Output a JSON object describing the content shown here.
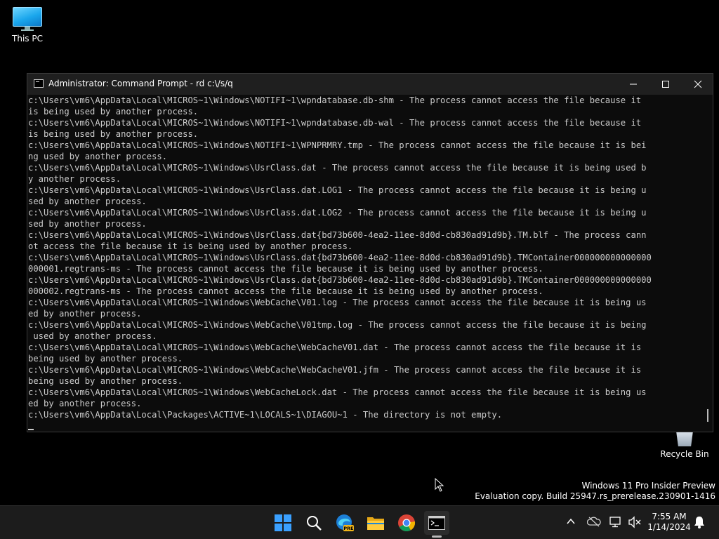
{
  "desktop": {
    "icons": [
      {
        "label": "This PC"
      },
      {
        "label": "Recycle Bin"
      }
    ]
  },
  "window": {
    "title": "Administrator: Command Prompt - rd  c:\\/s/q",
    "console_lines": [
      "c:\\Users\\vm6\\AppData\\Local\\MICROS~1\\Windows\\NOTIFI~1\\wpndatabase.db-shm - The process cannot access the file because it",
      "is being used by another process.",
      "c:\\Users\\vm6\\AppData\\Local\\MICROS~1\\Windows\\NOTIFI~1\\wpndatabase.db-wal - The process cannot access the file because it",
      "is being used by another process.",
      "c:\\Users\\vm6\\AppData\\Local\\MICROS~1\\Windows\\NOTIFI~1\\WPNPRMRY.tmp - The process cannot access the file because it is bei",
      "ng used by another process.",
      "c:\\Users\\vm6\\AppData\\Local\\MICROS~1\\Windows\\UsrClass.dat - The process cannot access the file because it is being used b",
      "y another process.",
      "c:\\Users\\vm6\\AppData\\Local\\MICROS~1\\Windows\\UsrClass.dat.LOG1 - The process cannot access the file because it is being u",
      "sed by another process.",
      "c:\\Users\\vm6\\AppData\\Local\\MICROS~1\\Windows\\UsrClass.dat.LOG2 - The process cannot access the file because it is being u",
      "sed by another process.",
      "c:\\Users\\vm6\\AppData\\Local\\MICROS~1\\Windows\\UsrClass.dat{bd73b600-4ea2-11ee-8d0d-cb830ad91d9b}.TM.blf - The process cann",
      "ot access the file because it is being used by another process.",
      "c:\\Users\\vm6\\AppData\\Local\\MICROS~1\\Windows\\UsrClass.dat{bd73b600-4ea2-11ee-8d0d-cb830ad91d9b}.TMContainer000000000000000",
      "000001.regtrans-ms - The process cannot access the file because it is being used by another process.",
      "c:\\Users\\vm6\\AppData\\Local\\MICROS~1\\Windows\\UsrClass.dat{bd73b600-4ea2-11ee-8d0d-cb830ad91d9b}.TMContainer000000000000000",
      "000002.regtrans-ms - The process cannot access the file because it is being used by another process.",
      "c:\\Users\\vm6\\AppData\\Local\\MICROS~1\\Windows\\WebCache\\V01.log - The process cannot access the file because it is being us",
      "ed by another process.",
      "c:\\Users\\vm6\\AppData\\Local\\MICROS~1\\Windows\\WebCache\\V01tmp.log - The process cannot access the file because it is being",
      " used by another process.",
      "c:\\Users\\vm6\\AppData\\Local\\MICROS~1\\Windows\\WebCache\\WebCacheV01.dat - The process cannot access the file because it is",
      "being used by another process.",
      "c:\\Users\\vm6\\AppData\\Local\\MICROS~1\\Windows\\WebCache\\WebCacheV01.jfm - The process cannot access the file because it is",
      "being used by another process.",
      "c:\\Users\\vm6\\AppData\\Local\\MICROS~1\\Windows\\WebCacheLock.dat - The process cannot access the file because it is being us",
      "ed by another process.",
      "c:\\Users\\vm6\\AppData\\Local\\Packages\\ACTIVE~1\\LOCALS~1\\DIAGOU~1 - The directory is not empty."
    ]
  },
  "watermark": {
    "line1": "Windows 11 Pro Insider Preview",
    "line2": "Evaluation copy. Build 25947.rs_prerelease.230901-1416"
  },
  "taskbar": {
    "apps": [
      "start-icon",
      "search-icon",
      "edge-icon",
      "file-explorer-icon",
      "chrome-icon",
      "command-prompt-icon"
    ],
    "edge_badge": "PRE",
    "clock": {
      "time": "7:55 AM",
      "date": "1/14/2024"
    }
  },
  "colors": {
    "console_bg": "#0c0c0c",
    "console_fg": "#cccccc",
    "titlebar_bg": "#1f1f1f",
    "taskbar_bg": "#1c1c1c"
  }
}
